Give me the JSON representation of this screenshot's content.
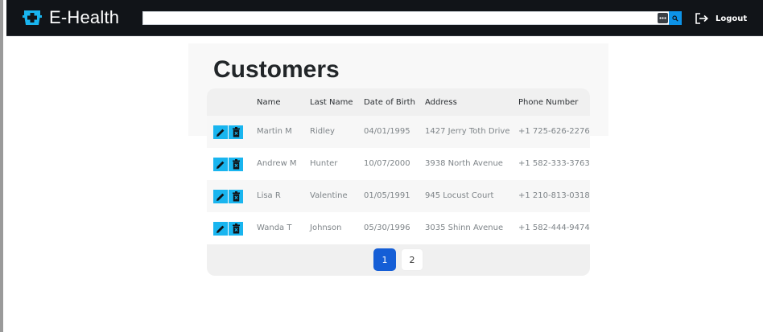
{
  "header": {
    "brand": "E-Health",
    "search": {
      "value": "",
      "placeholder": ""
    },
    "logout_label": "Logout"
  },
  "main": {
    "title": "Customers",
    "table": {
      "columns": [
        "",
        "Name",
        "Last Name",
        "Date of Birth",
        "Address",
        "Phone Number"
      ],
      "rows": [
        {
          "name": "Martin M",
          "last_name": "Ridley",
          "dob": "04/01/1995",
          "address": "1427 Jerry Toth Drive",
          "phone": "+1 725-626-2276"
        },
        {
          "name": "Andrew M",
          "last_name": "Hunter",
          "dob": "10/07/2000",
          "address": "3938 North Avenue",
          "phone": "+1 582-333-3763"
        },
        {
          "name": "Lisa R",
          "last_name": "Valentine",
          "dob": "01/05/1991",
          "address": "945 Locust Court",
          "phone": "+1 210-813-0318"
        },
        {
          "name": "Wanda T",
          "last_name": "Johnson",
          "dob": "05/30/1996",
          "address": "3035 Shinn Avenue",
          "phone": "+1 582-444-9474"
        }
      ]
    },
    "pagination": {
      "pages": [
        "1",
        "2"
      ],
      "current": "1"
    }
  },
  "icons": {
    "brand": "medical-cross-icon",
    "options": "more-options-icon",
    "search": "search-icon",
    "logout": "logout-icon",
    "edit": "pencil-icon",
    "delete": "trash-icon"
  },
  "colors": {
    "navbar": "#111418",
    "accent": "#19b5ef",
    "search_button": "#0d93e8",
    "active_page": "#155ed6"
  }
}
